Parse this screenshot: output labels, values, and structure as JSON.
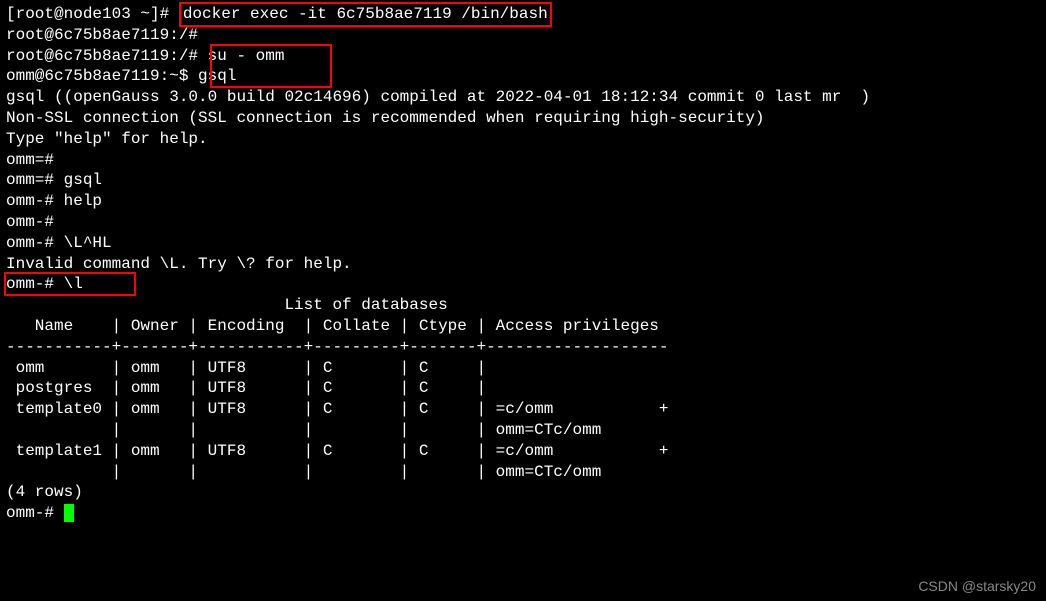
{
  "host_prompt_prefix": "[root@node103 ~]# ",
  "docker_cmd": "docker exec -it 6c75b8ae7119 /bin/bash",
  "container_prompt_root": "root@6c75b8ae7119:/#",
  "su_cmd": " su - omm",
  "omm_shell_prompt": "omm@6c75b8ae7119:~$",
  "gsql_cmd": " gsql",
  "gsql_banner": "gsql ((openGauss 3.0.0 build 02c14696) compiled at 2022-04-01 18:12:34 commit 0 last mr  )",
  "ssl_line": "Non-SSL connection (SSL connection is recommended when requiring high-security)",
  "help_line": "Type \"help\" for help.",
  "blank": "",
  "p1": "omm=#",
  "p2": "omm=# gsql",
  "p3": "omm-# help",
  "p4": "omm-#",
  "p5": "omm-# \\L^HL",
  "invalid": "Invalid command \\L. Try \\? for help.",
  "p6": "omm-# \\l",
  "list_title": "                             List of databases",
  "header": "   Name    | Owner | Encoding  | Collate | Ctype | Access privileges",
  "divider": "-----------+-------+-----------+---------+-------+-------------------",
  "rows": [
    " omm       | omm   | UTF8      | C       | C     |",
    " postgres  | omm   | UTF8      | C       | C     |",
    " template0 | omm   | UTF8      | C       | C     | =c/omm           +",
    "           |       |           |         |       | omm=CTc/omm",
    " template1 | omm   | UTF8      | C       | C     | =c/omm           +",
    "           |       |           |         |       | omm=CTc/omm"
  ],
  "rowcount": "(4 rows)",
  "final_prompt": "omm-# ",
  "watermark": "CSDN @starsky20"
}
